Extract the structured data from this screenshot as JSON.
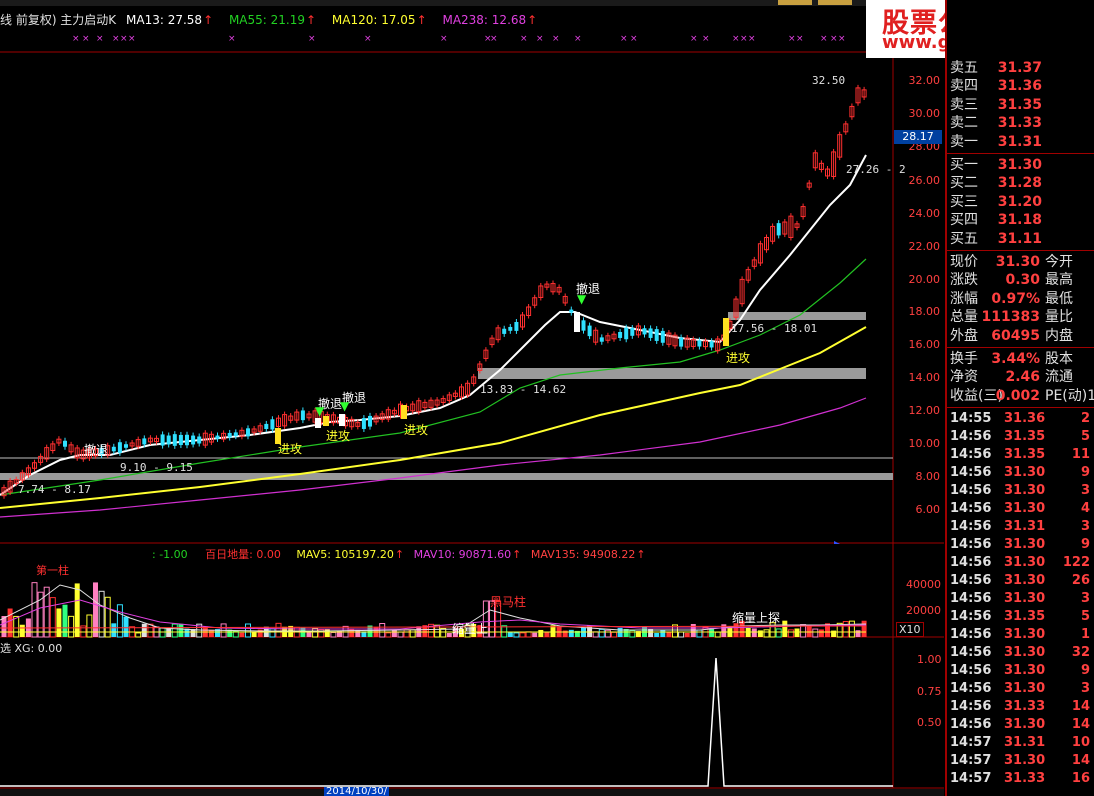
{
  "header": {
    "title": "线 前复权) 主力启动K",
    "ma13": "MA13: 27.58",
    "ma55": "MA55: 21.19",
    "ma120": "MA120: 17.05",
    "ma238": "MA238: 12.68",
    "arrow": "↑"
  },
  "price_axis": [
    "32.00",
    "30.00",
    "28.00",
    "26.00",
    "24.00",
    "22.00",
    "20.00",
    "18.00",
    "16.00",
    "14.00",
    "12.00",
    "10.00",
    "8.00",
    "6.00"
  ],
  "price_flag": "28.17",
  "price_annotations": {
    "high": "32.50",
    "ma_label": "27.26 - 2",
    "zone1": "17.56 - 18.01",
    "zone2": "13.83 - 14.62",
    "zone3": "9.10 - 9.15",
    "zone4": "7.74 - 8.17"
  },
  "chart_labels": {
    "retreat": "撤退",
    "attack": "进攻"
  },
  "volume_header": {
    "v1": ": -1.00",
    "v2": "百日地量: 0.00",
    "mav5": "MAV5: 105197.20",
    "mav10": "MAV10: 90871.60",
    "mav135": "MAV135: 94908.22"
  },
  "volume_axis": [
    "40000",
    "20000"
  ],
  "volume_unit": "X10",
  "volume_labels": {
    "first": "第一柱",
    "black_horse": "黑马柱",
    "shrink1": "缩量上",
    "shrink2": "缩量上探"
  },
  "indicator_header": "选 XG: 0.00",
  "indicator_axis": [
    "1.00",
    "0.75",
    "0.50"
  ],
  "bottom_dates": [
    "2014/10/30/"
  ],
  "watermark": {
    "line1": "股票公式在线网",
    "line2": "www.gszx.com.cn"
  },
  "quote": {
    "asks": [
      {
        "label": "卖五",
        "price": "31.37"
      },
      {
        "label": "卖四",
        "price": "31.36"
      },
      {
        "label": "卖三",
        "price": "31.35"
      },
      {
        "label": "卖二",
        "price": "31.33"
      },
      {
        "label": "卖一",
        "price": "31.31"
      }
    ],
    "bids": [
      {
        "label": "买一",
        "price": "31.30"
      },
      {
        "label": "买二",
        "price": "31.28"
      },
      {
        "label": "买三",
        "price": "31.20"
      },
      {
        "label": "买四",
        "price": "31.18"
      },
      {
        "label": "买五",
        "price": "31.11"
      }
    ],
    "stats1": [
      {
        "l": "现价",
        "v": "31.30",
        "r": "今开"
      },
      {
        "l": "涨跌",
        "v": "0.30",
        "r": "最高"
      },
      {
        "l": "涨幅",
        "v": "0.97%",
        "r": "最低"
      },
      {
        "l": "总量",
        "v": "111383",
        "r": "量比"
      },
      {
        "l": "外盘",
        "v": "60495",
        "r": "内盘"
      }
    ],
    "stats2": [
      {
        "l": "换手",
        "v": "3.44%",
        "r": "股本"
      },
      {
        "l": "净资",
        "v": "2.46",
        "r": "流通"
      },
      {
        "l": "收益(三)",
        "v": "0.002",
        "r": "PE(动)1"
      }
    ],
    "ticks": [
      {
        "t": "14:55",
        "p": "31.36",
        "v": "2"
      },
      {
        "t": "14:56",
        "p": "31.35",
        "v": "5"
      },
      {
        "t": "14:56",
        "p": "31.35",
        "v": "11"
      },
      {
        "t": "14:56",
        "p": "31.30",
        "v": "9"
      },
      {
        "t": "14:56",
        "p": "31.30",
        "v": "3"
      },
      {
        "t": "14:56",
        "p": "31.30",
        "v": "4"
      },
      {
        "t": "14:56",
        "p": "31.31",
        "v": "3"
      },
      {
        "t": "14:56",
        "p": "31.30",
        "v": "9"
      },
      {
        "t": "14:56",
        "p": "31.30",
        "v": "122"
      },
      {
        "t": "14:56",
        "p": "31.30",
        "v": "26"
      },
      {
        "t": "14:56",
        "p": "31.30",
        "v": "3"
      },
      {
        "t": "14:56",
        "p": "31.35",
        "v": "5"
      },
      {
        "t": "14:56",
        "p": "31.30",
        "v": "1"
      },
      {
        "t": "14:56",
        "p": "31.30",
        "v": "32"
      },
      {
        "t": "14:56",
        "p": "31.30",
        "v": "9"
      },
      {
        "t": "14:56",
        "p": "31.30",
        "v": "3"
      },
      {
        "t": "14:56",
        "p": "31.33",
        "v": "14"
      },
      {
        "t": "14:56",
        "p": "31.30",
        "v": "14"
      },
      {
        "t": "14:57",
        "p": "31.31",
        "v": "10"
      },
      {
        "t": "14:57",
        "p": "31.30",
        "v": "14"
      },
      {
        "t": "14:57",
        "p": "31.33",
        "v": "16"
      }
    ]
  },
  "colors": {
    "up": "#ff3030",
    "down": "#30e0ff",
    "ma13": "#ffffff",
    "ma55": "#22c022",
    "ma120": "#ffff30",
    "ma238": "#d030d0",
    "frame": "#a00000"
  }
}
